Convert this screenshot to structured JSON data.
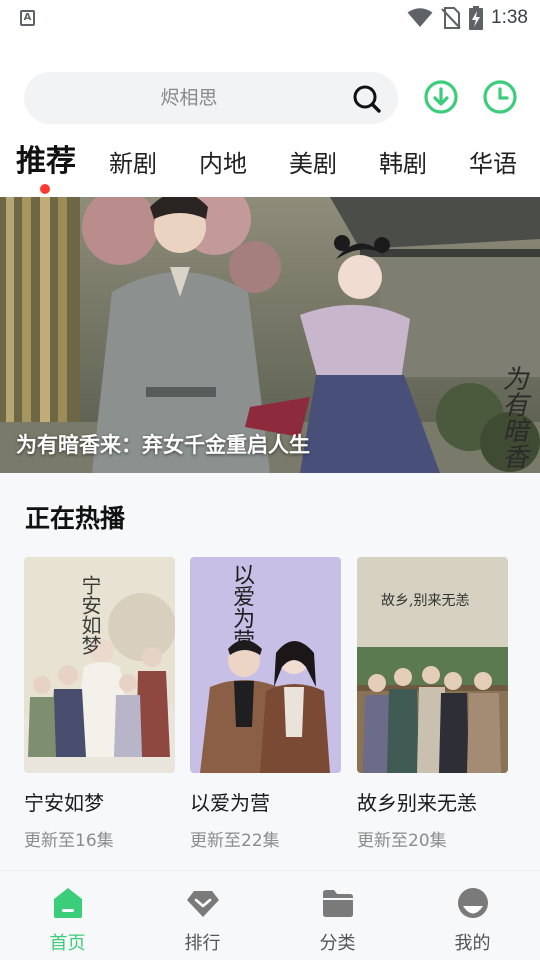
{
  "status_bar": {
    "app_icon_letter": "A",
    "time": "1:38"
  },
  "search": {
    "placeholder": "烬相思"
  },
  "colors": {
    "accent": "#3ccd7a",
    "active_dot": "#ff3b30"
  },
  "tabs": [
    {
      "label": "推荐",
      "active": true
    },
    {
      "label": "新剧",
      "active": false
    },
    {
      "label": "内地",
      "active": false
    },
    {
      "label": "美剧",
      "active": false
    },
    {
      "label": "韩剧",
      "active": false
    },
    {
      "label": "华语",
      "active": false
    }
  ],
  "banner": {
    "title": "为有暗香来：弃女千金重启人生",
    "logo_text": "为有暗香"
  },
  "hot_section": {
    "title": "正在热播",
    "items": [
      {
        "title": "宁安如梦",
        "update": "更新至16集",
        "poster_text": "宁安如梦"
      },
      {
        "title": "以爱为营",
        "update": "更新至22集",
        "poster_text": "以爱为营"
      },
      {
        "title": "故乡别来无恙",
        "update": "更新至20集",
        "poster_text": "故乡,别来无恙"
      }
    ]
  },
  "bottom_nav": [
    {
      "label": "首页",
      "icon": "home-icon",
      "active": true
    },
    {
      "label": "排行",
      "icon": "ranking-diamond-icon",
      "active": false
    },
    {
      "label": "分类",
      "icon": "folder-icon",
      "active": false
    },
    {
      "label": "我的",
      "icon": "profile-icon",
      "active": false
    }
  ]
}
